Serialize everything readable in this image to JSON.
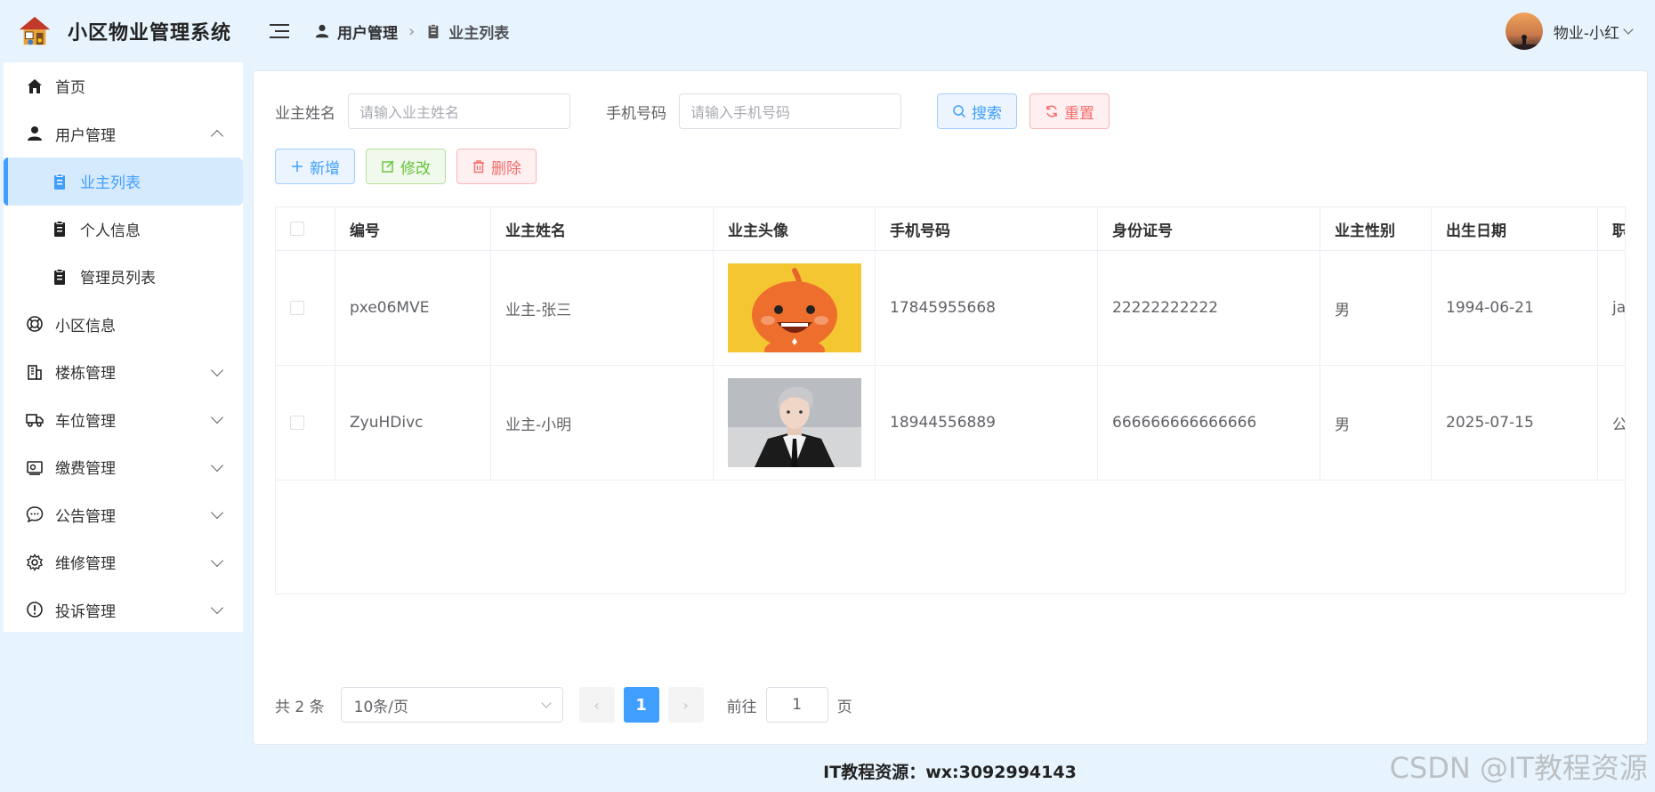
{
  "app": {
    "title": "小区物业管理系统"
  },
  "sidebar": {
    "items": [
      {
        "label": "首页",
        "icon": "home-icon"
      },
      {
        "label": "用户管理",
        "icon": "user-icon",
        "expanded": true
      },
      {
        "label": "业主列表",
        "icon": "clipboard-icon",
        "active": true
      },
      {
        "label": "个人信息",
        "icon": "clipboard-icon"
      },
      {
        "label": "管理员列表",
        "icon": "clipboard-icon"
      },
      {
        "label": "小区信息",
        "icon": "lifebuoy-icon"
      },
      {
        "label": "楼栋管理",
        "icon": "building-icon"
      },
      {
        "label": "车位管理",
        "icon": "truck-icon"
      },
      {
        "label": "缴费管理",
        "icon": "wallet-icon"
      },
      {
        "label": "公告管理",
        "icon": "chat-icon"
      },
      {
        "label": "维修管理",
        "icon": "gear-icon"
      },
      {
        "label": "投诉管理",
        "icon": "warning-icon"
      }
    ]
  },
  "header": {
    "breadcrumb": [
      "用户管理",
      "业主列表"
    ],
    "user_name": "物业-小红"
  },
  "search": {
    "name_label": "业主姓名",
    "name_placeholder": "请输入业主姓名",
    "phone_label": "手机号码",
    "phone_placeholder": "请输入手机号码",
    "search_label": "搜索",
    "reset_label": "重置"
  },
  "toolbar": {
    "add_label": "新增",
    "edit_label": "修改",
    "delete_label": "删除"
  },
  "table": {
    "columns": [
      "编号",
      "业主姓名",
      "业主头像",
      "手机号码",
      "身份证号",
      "业主性别",
      "出生日期",
      "职"
    ],
    "rows": [
      {
        "id": "pxe06MVE",
        "name": "业主-张三",
        "phone": "17845955668",
        "idcard": "22222222222",
        "gender": "男",
        "birth": "1994-06-21",
        "job": "ja"
      },
      {
        "id": "ZyuHDivc",
        "name": "业主-小明",
        "phone": "18944556889",
        "idcard": "666666666666666",
        "gender": "男",
        "birth": "2025-07-15",
        "job": "公"
      }
    ]
  },
  "pagination": {
    "total_text": "共 2 条",
    "page_size": "10条/页",
    "current_page": "1",
    "goto_prefix": "前往",
    "goto_value": "1",
    "goto_suffix": "页"
  },
  "footer": {
    "text": "IT教程资源：wx:3092994143"
  },
  "watermark": "CSDN @IT教程资源",
  "colors": {
    "accent": "#409eff",
    "danger": "#f56c6c",
    "success": "#67c23a",
    "background": "#e8f4fd"
  }
}
